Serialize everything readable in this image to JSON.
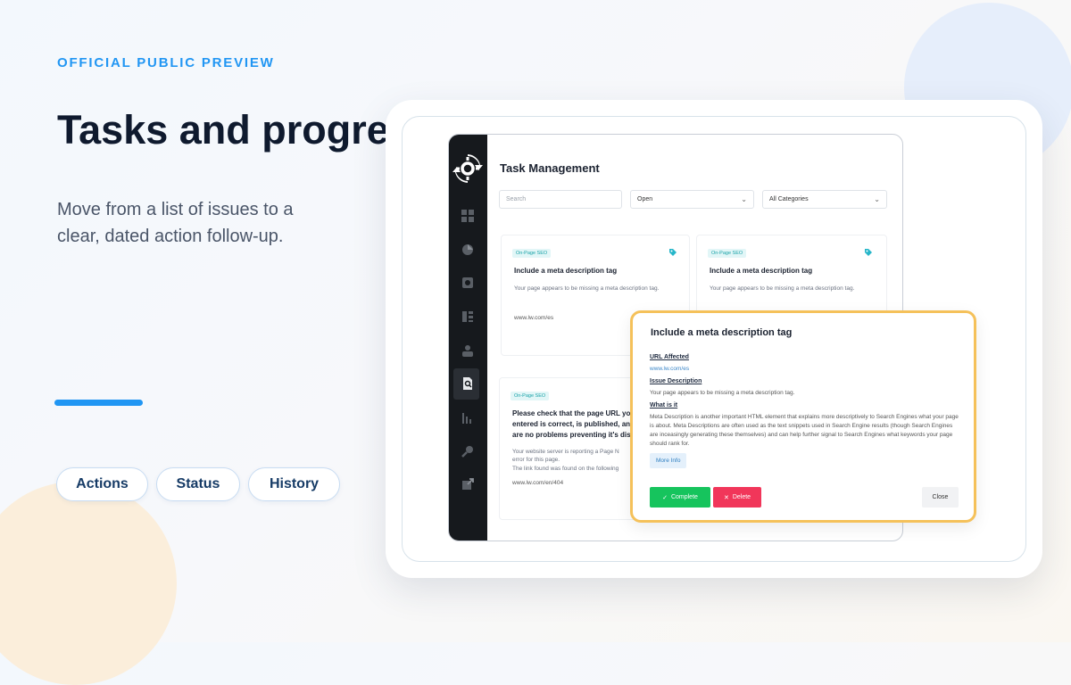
{
  "hero": {
    "eyebrow": "OFFICIAL PUBLIC PREVIEW",
    "title": "Tasks and progress",
    "subtitle": "Move from a list of issues to a clear, dated action follow-up."
  },
  "pills": [
    "Actions",
    "Status",
    "History"
  ],
  "app": {
    "title": "Task Management",
    "filters": {
      "search_placeholder": "Search",
      "status_value": "Open",
      "category_value": "All Categories"
    },
    "cards": [
      {
        "tag": "On-Page SEO",
        "title": "Include a meta description tag",
        "description": "Your page appears to be missing a meta description tag.",
        "url": "www.lw.com/es"
      },
      {
        "tag": "On-Page SEO",
        "title": "Include a meta description tag",
        "description": "Your page appears to be missing a meta description tag."
      },
      {
        "tag": "On-Page SEO",
        "title_lines": [
          "Please check that the page URL you",
          "entered is correct, is published, and",
          "are no problems preventing it's disp"
        ],
        "description_lines": [
          "Your website server is reporting a Page N",
          "error for this page.",
          "The link found was found on the following"
        ],
        "url": "www.lw.com/en/404"
      }
    ]
  },
  "modal": {
    "title": "Include a meta description tag",
    "url_label": "URL Affected",
    "url_value": "www.lw.com/es",
    "issue_label": "Issue Description",
    "issue_text": "Your page appears to be missing a meta description tag.",
    "what_label": "What is it",
    "what_text": "Meta Description is another important HTML element that explains more descriptively to Search Engines what your page is about. Meta Descriptions are often used as the text snippets used in Search Engine results (though Search Engines are inceasingly generating these themselves) and can help further signal to Search Engines what keywords your page should rank for.",
    "more_info": "More Info",
    "complete": "Complete",
    "delete": "Delete",
    "close": "Close"
  },
  "colors": {
    "accent": "#2196f3",
    "highlight_border": "#f5c15a",
    "complete": "#16c45d",
    "delete": "#f1365a"
  },
  "icons": [
    "logo-icon",
    "dashboard-icon",
    "chart-icon",
    "report-icon",
    "list-icon",
    "users-icon",
    "search-doc-icon",
    "bar-chart-icon",
    "key-icon",
    "export-icon",
    "tag-icon",
    "check-icon",
    "x-icon"
  ]
}
